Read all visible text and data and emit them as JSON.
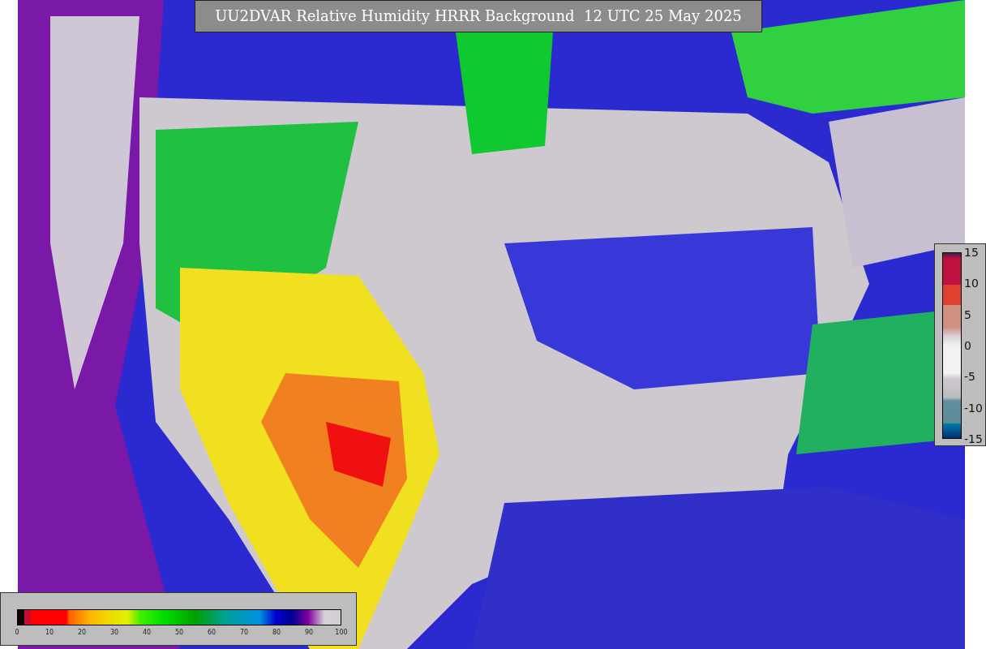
{
  "title": "UU2DVAR Relative Humidity HRRR Background  12 UTC 25 May 2025",
  "humidity_legend": {
    "ticks": [
      "0",
      "10",
      "20",
      "30",
      "40",
      "50",
      "60",
      "70",
      "80",
      "90",
      "100"
    ]
  },
  "difference_legend": {
    "ticks": [
      "15",
      "10",
      "5",
      "0",
      "-5",
      "-10",
      "-15"
    ]
  }
}
